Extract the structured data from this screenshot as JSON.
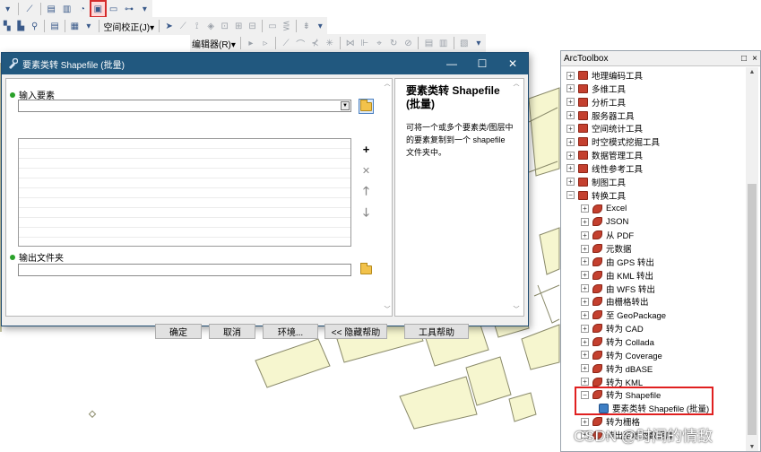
{
  "toolbars": {
    "spatial_adjust_label": "空间校正(J)▾",
    "editor_label": "编辑器(R)▾"
  },
  "dialog": {
    "title": "要素类转 Shapefile (批量)",
    "window_buttons": {
      "minimize": "—",
      "maximize": "☐",
      "close": "✕"
    },
    "input_label": "输入要素",
    "output_label": "输出文件夹",
    "input_value": "",
    "output_value": "",
    "side_buttons": {
      "add": "+",
      "remove": "✕",
      "up": "🡑",
      "down": "🡓"
    },
    "help": {
      "title": "要素类转 Shapefile (批量)",
      "text": "可将一个或多个要素类/图层中的要素复制到一个 shapefile 文件夹中。"
    },
    "buttons": {
      "ok": "确定",
      "cancel": "取消",
      "env": "环境...",
      "hide_help": "<< 隐藏帮助",
      "tool_help": "工具帮助"
    }
  },
  "arctoolbox": {
    "title": "ArcToolbox",
    "header_icons": {
      "pin": "□",
      "close": "×"
    },
    "items": [
      {
        "label": "地理编码工具",
        "kind": "toolbox",
        "level": 0,
        "expander": "+"
      },
      {
        "label": "多维工具",
        "kind": "toolbox",
        "level": 0,
        "expander": "+"
      },
      {
        "label": "分析工具",
        "kind": "toolbox",
        "level": 0,
        "expander": "+"
      },
      {
        "label": "服务器工具",
        "kind": "toolbox",
        "level": 0,
        "expander": "+"
      },
      {
        "label": "空间统计工具",
        "kind": "toolbox",
        "level": 0,
        "expander": "+"
      },
      {
        "label": "时空模式挖掘工具",
        "kind": "toolbox",
        "level": 0,
        "expander": "+"
      },
      {
        "label": "数据管理工具",
        "kind": "toolbox",
        "level": 0,
        "expander": "+"
      },
      {
        "label": "线性参考工具",
        "kind": "toolbox",
        "level": 0,
        "expander": "+"
      },
      {
        "label": "制图工具",
        "kind": "toolbox",
        "level": 0,
        "expander": "+"
      },
      {
        "label": "转换工具",
        "kind": "toolbox",
        "level": 0,
        "expander": "−"
      },
      {
        "label": "Excel",
        "kind": "toolset",
        "level": 1,
        "expander": "+"
      },
      {
        "label": "JSON",
        "kind": "toolset",
        "level": 1,
        "expander": "+"
      },
      {
        "label": "从 PDF",
        "kind": "toolset",
        "level": 1,
        "expander": "+"
      },
      {
        "label": "元数据",
        "kind": "toolset",
        "level": 1,
        "expander": "+"
      },
      {
        "label": "由 GPS 转出",
        "kind": "toolset",
        "level": 1,
        "expander": "+"
      },
      {
        "label": "由 KML 转出",
        "kind": "toolset",
        "level": 1,
        "expander": "+"
      },
      {
        "label": "由 WFS 转出",
        "kind": "toolset",
        "level": 1,
        "expander": "+"
      },
      {
        "label": "由栅格转出",
        "kind": "toolset",
        "level": 1,
        "expander": "+"
      },
      {
        "label": "至 GeoPackage",
        "kind": "toolset",
        "level": 1,
        "expander": "+"
      },
      {
        "label": "转为 CAD",
        "kind": "toolset",
        "level": 1,
        "expander": "+"
      },
      {
        "label": "转为 Collada",
        "kind": "toolset",
        "level": 1,
        "expander": "+"
      },
      {
        "label": "转为 Coverage",
        "kind": "toolset",
        "level": 1,
        "expander": "+"
      },
      {
        "label": "转为 dBASE",
        "kind": "toolset",
        "level": 1,
        "expander": "+"
      },
      {
        "label": "转为 KML",
        "kind": "toolset",
        "level": 1,
        "expander": "+"
      },
      {
        "label": "转为 Shapefile",
        "kind": "toolset",
        "level": 1,
        "expander": "−"
      },
      {
        "label": "要素类转 Shapefile (批量)",
        "kind": "tool",
        "level": 2,
        "expander": ""
      },
      {
        "label": "转为栅格",
        "kind": "toolset",
        "level": 1,
        "expander": "+"
      },
      {
        "label": "转出至地理数据库",
        "kind": "toolset",
        "level": 1,
        "expander": "+"
      }
    ]
  },
  "watermark": "CSDN @时间的情敌",
  "colors": {
    "title_bar": "#21587f",
    "highlight_box": "#e02020",
    "map_fill": "#fafad2"
  }
}
